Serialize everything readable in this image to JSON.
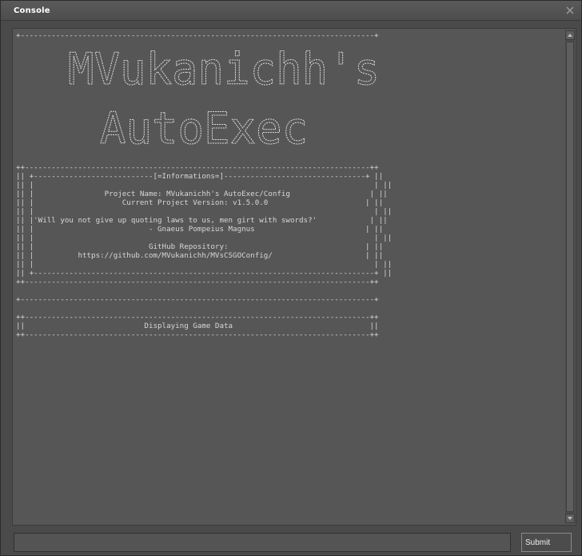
{
  "window": {
    "title": "Console",
    "close_icon": "close-icon"
  },
  "console": {
    "output": "+--------------------------------------------------------------------------------+\n\n\n\n\n\n\n\n\n\n\n\n\n\n\n++------------------------------------------------------------------------------++\n|| +---------------------------[=Informations=]--------------------------------+ ||\n|| |                                                                             | ||\n|| |                Project Name: MVukanichh's AutoExec/Config                  | ||\n|| |                    Current Project Version: v1.5.0.0                      | ||\n|| |                                                                             | ||\n|| |'Will you not give up quoting laws to us, men girt with swords?'            | ||\n|| |                          - Gnaeus Pompeius Magnus                         | ||\n|| |                                                                             | ||\n|| |                          GitHub Repository:                               | ||\n|| |          https://github.com/MVukanichh/MVsCSGOConfig/                     | ||\n|| |                                                                             | ||\n|| +-----------------------------------------------------------------------------+ ||\n++------------------------------------------------------------------------------++\n\n+--------------------------------------------------------------------------------+\n\n++------------------------------------------------------------------------------++\n||                           Displaying Game Data                               ||\n++------------------------------------------------------------------------------++",
    "banner_line1": "MVukanichh's",
    "banner_line2": "AutoExec"
  },
  "input": {
    "value": "",
    "placeholder": ""
  },
  "submit_label": "Submit"
}
